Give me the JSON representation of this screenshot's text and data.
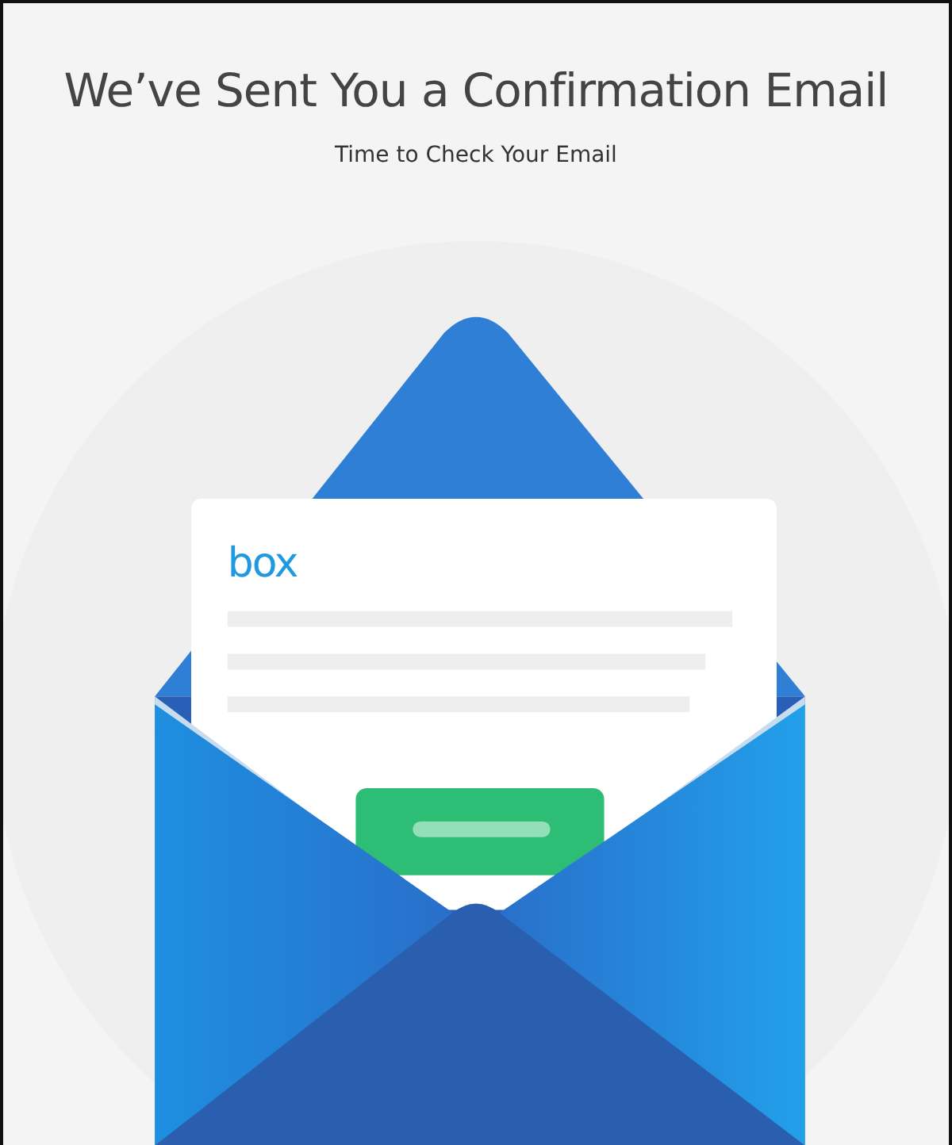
{
  "title": "We’ve Sent You a Confirmation Email",
  "subtitle": "Time to Check Your Email",
  "letter": {
    "logo": "box"
  }
}
